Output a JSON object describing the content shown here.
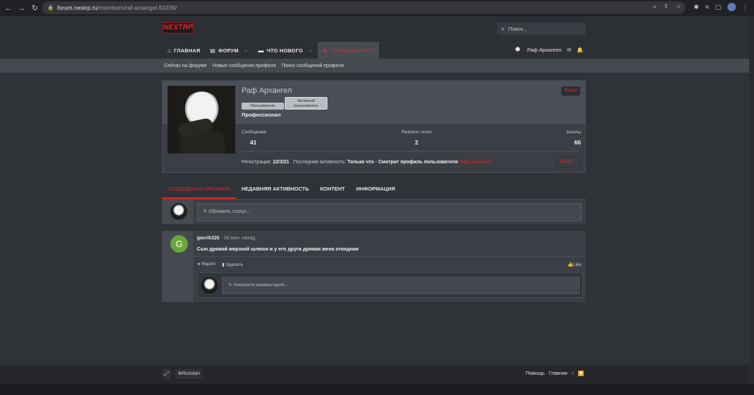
{
  "browser": {
    "url_host": "forum.nextrp.ru",
    "url_path": "/members/raf-arxangel.83239/"
  },
  "header": {
    "logo_text": "NEXTRP",
    "search_placeholder": "Поиск...",
    "nav": [
      {
        "label": "ГЛАВНАЯ"
      },
      {
        "label": "ФОРУМ"
      },
      {
        "label": "ЧТО НОВОГО"
      },
      {
        "label": "ПОЛЬЗОВАТЕЛИ"
      }
    ],
    "user_name": "Раф Архангел"
  },
  "subnav": [
    "Сейчас на форуме",
    "Новые сообщения профиля",
    "Поиск сообщений профиля"
  ],
  "profile": {
    "name": "Раф Архангел",
    "badge_user": "Пользователь",
    "badge_active_line1": "Активный",
    "badge_active_line2": "пользователь",
    "rank": "Профессионал",
    "report_label": "Report",
    "stats": [
      {
        "label": "Сообщения",
        "value": "41"
      },
      {
        "label": "Reaction score",
        "value": "2"
      },
      {
        "label": "Баллы",
        "value": "66"
      }
    ],
    "reg_label": "Регистрация:",
    "reg_date": "22/3/21",
    "last_label": "Последняя активность:",
    "last_value": "Только что · Смотрит профиль пользователя",
    "last_user": "Раф Архангел",
    "find_label": "Найти"
  },
  "tabs": [
    "СООБЩЕНИЯ ПРОФИЛЯ",
    "НЕДАВНЯЯ АКТИВНОСТЬ",
    "КОНТЕНТ",
    "ИНФОРМАЦИЯ"
  ],
  "status": {
    "placeholder": "Обновить статус..."
  },
  "post": {
    "avatar_letter": "G",
    "author": "gavrik326",
    "time": "· 38 мин. назад",
    "text": "Сын дрявой мерзкой шлюхи и у его друга дрявая жена откидная",
    "report": "Report",
    "delete": "Удалить",
    "like": "Like",
    "comment_placeholder": "Напишите комментарий..."
  },
  "footer": {
    "lang": "Russian",
    "help": "Помощь",
    "home": "Главная"
  }
}
